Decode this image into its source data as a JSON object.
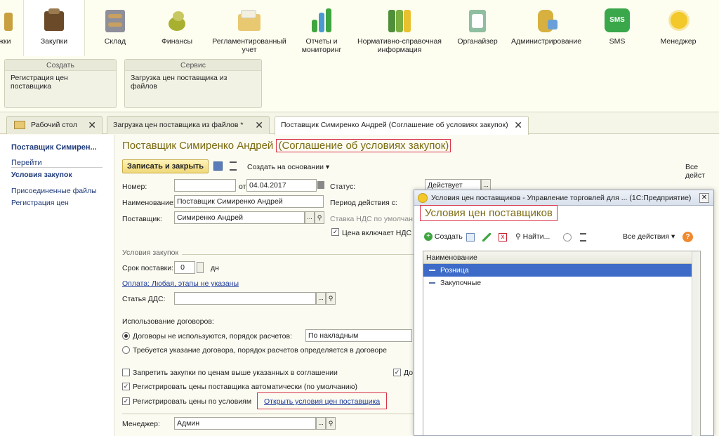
{
  "top_panel": {
    "items": [
      {
        "label": "жки",
        "color": "#c8a040"
      },
      {
        "label": "Закупки",
        "color": "#6b4a2a"
      },
      {
        "label": "Склад",
        "color": "#8f8f9a"
      },
      {
        "label": "Финансы",
        "color": "#a8b030"
      },
      {
        "label": "Регламентированный учет",
        "color": "#e8c870"
      },
      {
        "label": "Отчеты и мониторинг",
        "color": "#3fa540"
      },
      {
        "label": "Нормативно-справочная информация",
        "color": "#4f8f3a"
      },
      {
        "label": "Органайзер",
        "color": "#8fbfa0"
      },
      {
        "label": "Администрирование",
        "color": "#d8b040"
      },
      {
        "label": "SMS",
        "color": "#39a74a"
      },
      {
        "label": "Менеджер",
        "color": "#f2c82a"
      }
    ],
    "sms_badge": "SMS"
  },
  "command_groups": [
    {
      "header": "Создать",
      "item": "Регистрация цен поставщика"
    },
    {
      "header": "Сервис",
      "item": "Загрузка цен поставщика из файлов"
    }
  ],
  "tabs": [
    {
      "label": "Рабочий стол"
    },
    {
      "label": "Загрузка цен поставщика из файлов *"
    },
    {
      "label": "Поставщик Симиренко Андрей (Соглашение об условиях закупок)"
    }
  ],
  "tab_close": "✕",
  "left_nav": {
    "title": "Поставщик Симирен...",
    "section": "Перейти",
    "items": [
      "Условия закупок",
      "Присоединенные файлы",
      "Регистрация цен"
    ]
  },
  "form": {
    "title_main": "Поставщик Симиренко Андрей",
    "title_paren": "(Соглашение об условиях закупок)",
    "save_close": "Записать и закрыть",
    "create_based": "Создать на основании ▾",
    "all_actions": "Все дейст",
    "number_label": "Номер:",
    "from_label": "от:",
    "date": "04.04.2017",
    "status_label": "Статус:",
    "status_value": "Действует",
    "name_label": "Наименование:",
    "name_value": "Поставщик Симиренко Андрей",
    "period_label": "Период действия с:",
    "supplier_label": "Поставщик:",
    "supplier_value": "Симиренко Андрей",
    "vat_label": "Ставка НДС по умолчан",
    "price_incl_vat": "Цена включает НДС",
    "purchase_terms": "Условия закупок",
    "delivery_label": "Срок поставки:",
    "delivery_value": "0",
    "days": "дн",
    "payment_link": "Оплата: Любая, этапы не указаны",
    "dds_label": "Статья ДДС:",
    "contracts_label": "Использование договоров:",
    "radio1": "Договоры не используются, порядок расчетов:",
    "radio1_value": "По накладным",
    "radio2": "Требуется указание договора, порядок расчетов определяется в договоре",
    "chk1": "Запретить закупки по ценам выше указанных в соглашении",
    "chk2": "Регистрировать цены поставщика автоматически (по умолчанию)",
    "chk3": "Регистрировать цены по условиям",
    "chk_right": "До",
    "open_conditions": "Открыть условия цен поставщика",
    "manager_label": "Менеджер:",
    "manager_value": "Админ",
    "dots": "...",
    "check_mark": "✓"
  },
  "dialog": {
    "window_title": "Условия цен поставщиков - Управление торговлей для ... (1С:Предприятие)",
    "title": "Условия цен поставщиков",
    "create": "Создать",
    "find": "Найти...",
    "all_actions": "Все действия ▾",
    "help": "?",
    "close": "✕",
    "column_header": "Наименование",
    "rows": [
      "Розница",
      "Закупочные"
    ]
  }
}
